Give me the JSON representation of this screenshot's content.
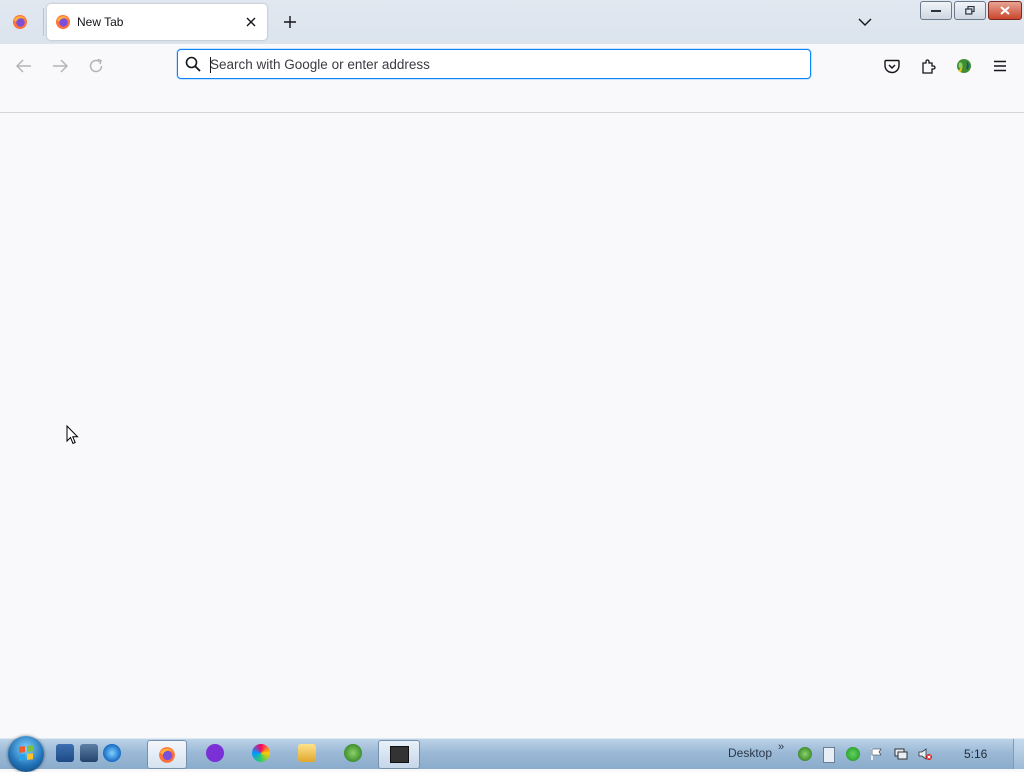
{
  "browser": {
    "tab": {
      "title": "New Tab",
      "close_icon": "close-icon",
      "favicon": "firefox-icon"
    },
    "new_tab_icon": "plus-icon",
    "list_all_tabs_icon": "chevron-down-icon",
    "window_controls": [
      "minimize",
      "restore",
      "close"
    ]
  },
  "toolbar": {
    "back_icon": "arrow-left-icon",
    "forward_icon": "arrow-right-icon",
    "reload_icon": "reload-icon",
    "urlbar": {
      "placeholder": "Search with Google or enter address",
      "value": ""
    },
    "right_icons": [
      "pocket-icon",
      "extensions-icon",
      "extension-globe-icon",
      "menu-icon"
    ]
  },
  "taskbar": {
    "desktop_label": "Desktop",
    "overflow_label": "»",
    "clock": "5:16",
    "apps": [
      "firefox",
      "app-purple",
      "app-colorwheel",
      "app-folder",
      "app-globe",
      "app-terminal"
    ]
  },
  "colors": {
    "accent": "#0a84ff",
    "tabstrip": "#dbe3ec",
    "content": "#f9f9fb"
  }
}
